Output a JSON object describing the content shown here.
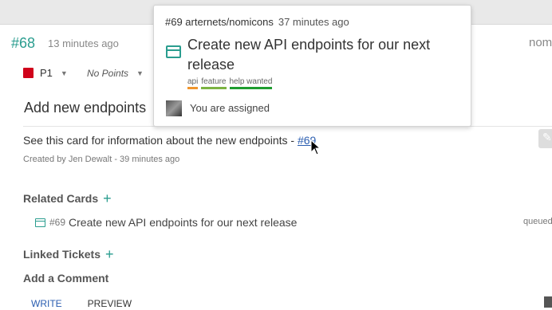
{
  "card": {
    "number": "#68",
    "time_ago": "13 minutes ago",
    "right_cut": "nom",
    "priority": "P1",
    "points": "No Points",
    "title": "Add new endpoints",
    "description_prefix": "See this card for information about the new endpoints - ",
    "description_link": "#69",
    "created_by": "Created by Jen Dewalt - 39 minutes ago"
  },
  "related": {
    "heading": "Related Cards",
    "items": [
      {
        "number": "#69",
        "title": "Create new API endpoints for our next release",
        "status": "queued"
      }
    ]
  },
  "linked": {
    "heading": "Linked Tickets"
  },
  "comment": {
    "heading": "Add a Comment",
    "tabs": [
      "WRITE",
      "PREVIEW"
    ]
  },
  "popover": {
    "ref": "#69 arternets/nomicons",
    "time_ago": "37 minutes ago",
    "title": "Create new API endpoints for our next release",
    "labels": [
      {
        "name": "api",
        "color": "#f0952d"
      },
      {
        "name": "feature",
        "color": "#7cb342"
      },
      {
        "name": "help wanted",
        "color": "#1e9c2f"
      }
    ],
    "assigned_text": "You are assigned"
  },
  "colors": {
    "accent": "#2a9d8f",
    "priority": "#d0021b",
    "link": "#2a5db0"
  }
}
